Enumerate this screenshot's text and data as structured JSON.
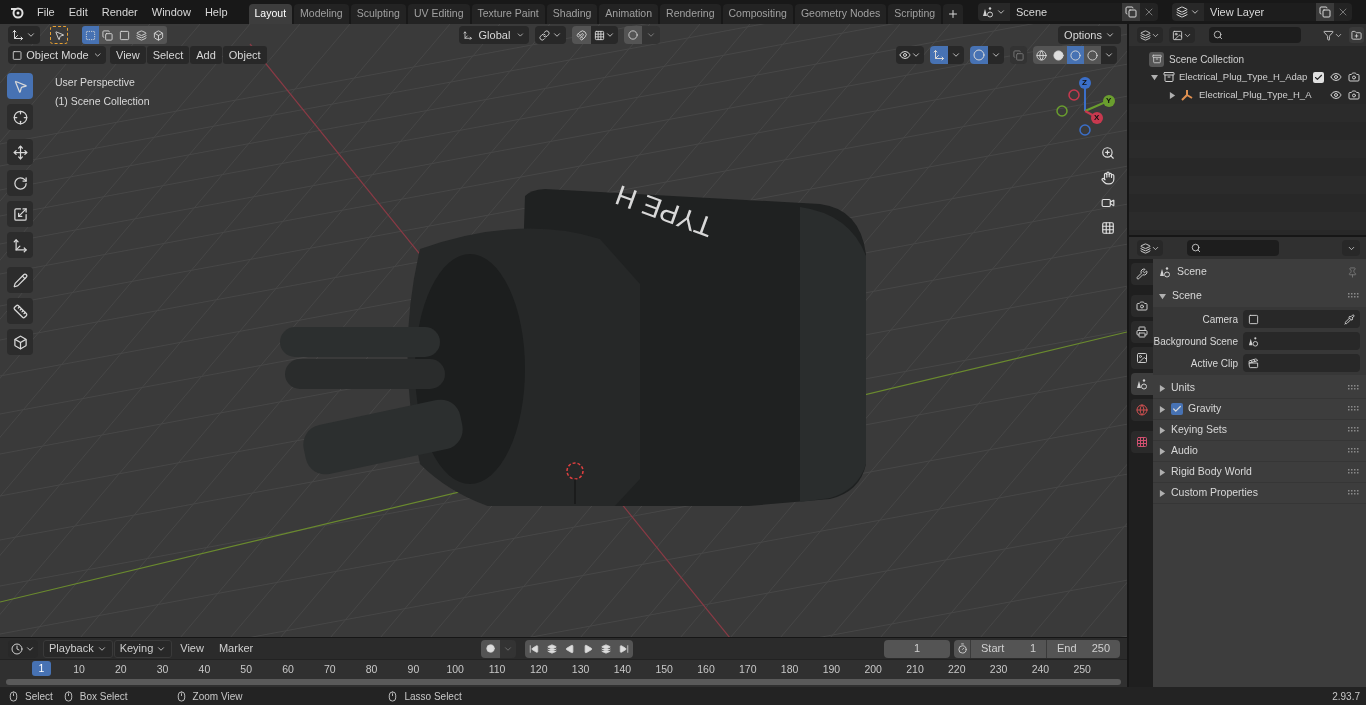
{
  "menu": [
    "File",
    "Edit",
    "Render",
    "Window",
    "Help"
  ],
  "workspaces": [
    {
      "label": "Layout",
      "selected": true
    },
    {
      "label": "Modeling",
      "selected": false
    },
    {
      "label": "Sculpting",
      "selected": false
    },
    {
      "label": "UV Editing",
      "selected": false
    },
    {
      "label": "Texture Paint",
      "selected": false
    },
    {
      "label": "Shading",
      "selected": false
    },
    {
      "label": "Animation",
      "selected": false
    },
    {
      "label": "Rendering",
      "selected": false
    },
    {
      "label": "Compositing",
      "selected": false
    },
    {
      "label": "Geometry Nodes",
      "selected": false
    },
    {
      "label": "Scripting",
      "selected": false
    }
  ],
  "scene_selector": {
    "value": "Scene"
  },
  "view_layer_selector": {
    "value": "View Layer"
  },
  "tool_header": {
    "select_modes": [
      {
        "kind": "new",
        "selected": true
      },
      {
        "kind": "extend",
        "selected": false
      },
      {
        "kind": "subtract",
        "selected": false
      },
      {
        "kind": "invert",
        "selected": false
      },
      {
        "kind": "intersect",
        "selected": false
      }
    ],
    "orientation": "Global",
    "options": "Options"
  },
  "viewport_header": {
    "mode": "Object Mode",
    "menus": [
      "View",
      "Select",
      "Add",
      "Object"
    ],
    "shading_modes": [
      {
        "kind": "wireframe",
        "selected": false
      },
      {
        "kind": "solid",
        "selected": false
      },
      {
        "kind": "material",
        "selected": true
      },
      {
        "kind": "rendered",
        "selected": false
      }
    ]
  },
  "viewport": {
    "overlay_lines": [
      "User Perspective",
      "(1) Scene Collection"
    ],
    "model_label": "TYPE H",
    "gizmo_axes": [
      "Z",
      "Y",
      "X"
    ],
    "tools": [
      {
        "kind": "select",
        "selected": true
      },
      {
        "kind": "cursor",
        "selected": false
      },
      {
        "kind": "move",
        "selected": false
      },
      {
        "kind": "rotate",
        "selected": false
      },
      {
        "kind": "scale",
        "selected": false
      },
      {
        "kind": "transform",
        "selected": false
      },
      {
        "kind": "annotate",
        "selected": false
      },
      {
        "kind": "measure",
        "selected": false
      },
      {
        "kind": "add_cube",
        "selected": false
      }
    ]
  },
  "outliner": {
    "root": "Scene Collection",
    "items": [
      {
        "name": "Electrical_Plug_Type_H_Adap",
        "expanded": true,
        "checked": true,
        "children": [
          {
            "name": "Electrical_Plug_Type_H_A",
            "expanded": false
          }
        ]
      }
    ]
  },
  "properties": {
    "tabs": [
      {
        "kind": "tool",
        "selected": false
      },
      {
        "kind": "render",
        "selected": false
      },
      {
        "kind": "output",
        "selected": false
      },
      {
        "kind": "view_layer",
        "selected": false
      },
      {
        "kind": "scene",
        "selected": true
      },
      {
        "kind": "world",
        "selected": false
      },
      {
        "kind": "texture",
        "selected": false
      }
    ],
    "context": "Scene",
    "panel": {
      "title": "Scene",
      "expanded": true,
      "fields": [
        {
          "label": "Camera",
          "kind": "camera"
        },
        {
          "label": "Background Scene",
          "kind": "scene"
        },
        {
          "label": "Active Clip",
          "kind": "clip"
        }
      ]
    },
    "subpanels": [
      {
        "title": "Units",
        "expanded": false
      },
      {
        "title": "Gravity",
        "expanded": false,
        "checked": true
      },
      {
        "title": "Keying Sets",
        "expanded": false
      },
      {
        "title": "Audio",
        "expanded": false
      },
      {
        "title": "Rigid Body World",
        "expanded": false
      },
      {
        "title": "Custom Properties",
        "expanded": false
      }
    ]
  },
  "timeline": {
    "menus": [
      {
        "label": "Playback",
        "kind": "dropdown"
      },
      {
        "label": "Keying",
        "kind": "dropdown"
      },
      {
        "label": "View",
        "kind": "menu"
      },
      {
        "label": "Marker",
        "kind": "menu"
      }
    ],
    "current_frame": "1",
    "start_label": "Start",
    "start": "1",
    "end_label": "End",
    "end": "250",
    "playhead": "1",
    "ruler": [
      "10",
      "20",
      "30",
      "40",
      "50",
      "60",
      "70",
      "80",
      "90",
      "100",
      "110",
      "120",
      "130",
      "140",
      "150",
      "160",
      "170",
      "180",
      "190",
      "200",
      "210",
      "220",
      "230",
      "240",
      "250"
    ]
  },
  "status_bar": {
    "hints": [
      "Select",
      "Box Select",
      "Zoom View",
      "Lasso Select"
    ],
    "version": "2.93.7"
  }
}
